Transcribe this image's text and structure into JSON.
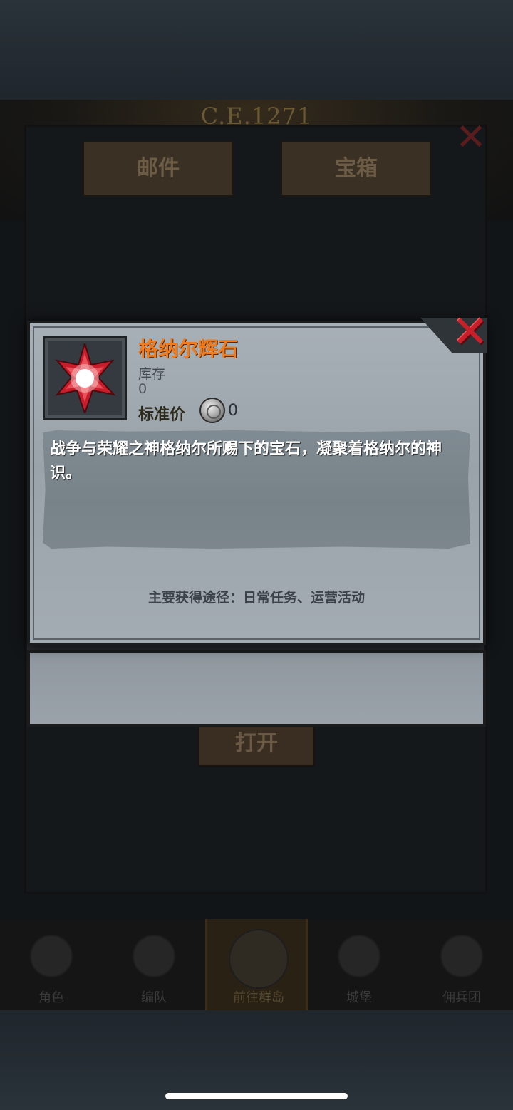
{
  "background": {
    "era": "C.E.1271"
  },
  "tabs": [
    {
      "label": "邮件"
    },
    {
      "label": "宝箱"
    }
  ],
  "back_actions": {
    "open_label": "打开"
  },
  "bottom_nav": [
    {
      "label": "角色"
    },
    {
      "label": "编队"
    },
    {
      "label": "前往群岛"
    },
    {
      "label": "城堡"
    },
    {
      "label": "佣兵团"
    }
  ],
  "item": {
    "name": "格纳尔辉石",
    "stock_label": "库存",
    "stock_value": "0",
    "price_label": "标准价",
    "price_value": "0",
    "description": "战争与荣耀之神格纳尔所赐下的宝石，凝聚着格纳尔的神识。",
    "source": "主要获得途径：日常任务、运营活动",
    "name_color": "#f07c1e",
    "gem_color": "#c81e2c",
    "close_color": "#c7202a"
  },
  "icons": {
    "close": "close-x-icon",
    "coin": "silver-coin-icon",
    "gem": "crimson-star-gem-icon"
  }
}
